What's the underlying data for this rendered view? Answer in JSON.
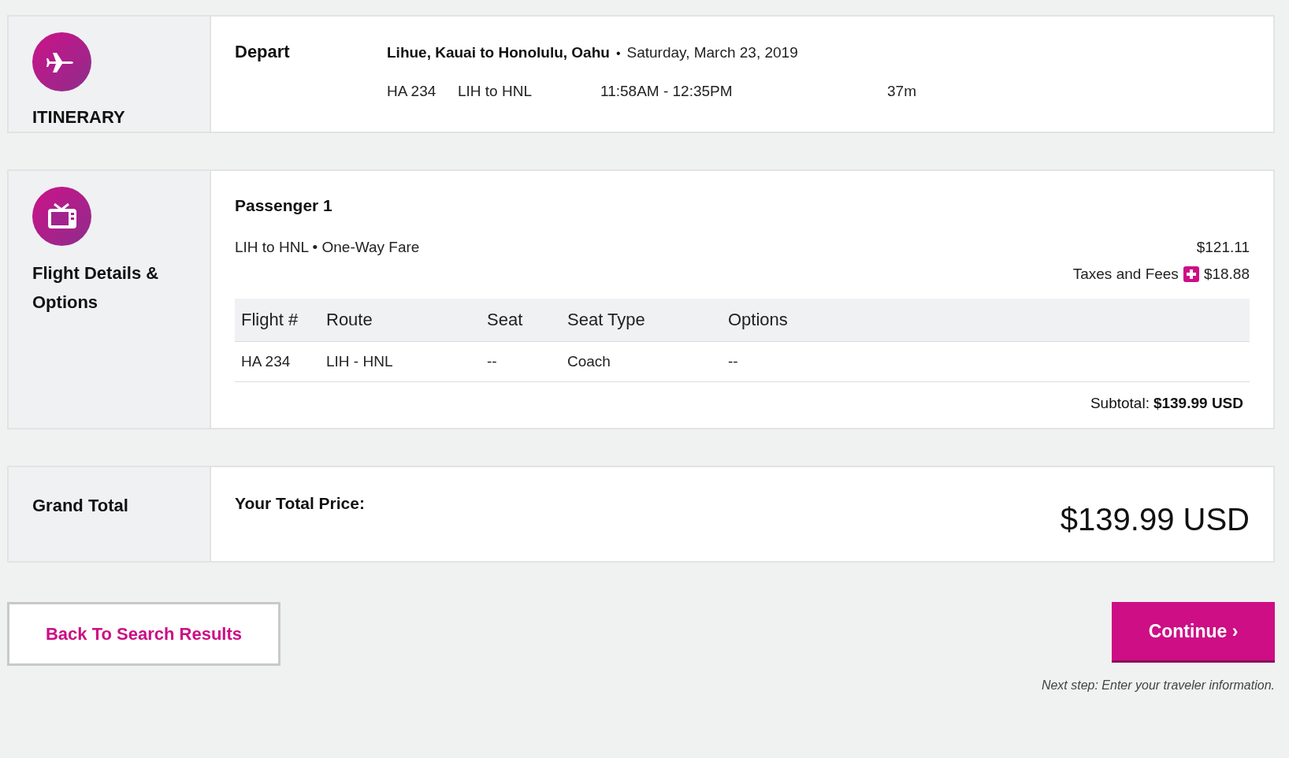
{
  "itinerary": {
    "heading": "ITINERARY",
    "label": "Depart",
    "route": "Lihue, Kauai to Honolulu, Oahu",
    "separator": "•",
    "date": "Saturday, March 23, 2019",
    "flight": {
      "number": "HA 234",
      "segment": "LIH to HNL",
      "time": "11:58AM - 12:35PM",
      "duration": "37m"
    }
  },
  "details": {
    "heading": "Flight Details & Options",
    "passenger": "Passenger 1",
    "fare_route": "LIH to HNL",
    "fare_separator": "•",
    "fare_type": "One-Way Fare",
    "fare_price": "$121.11",
    "taxes_label": "Taxes and Fees",
    "taxes_price": "$18.88",
    "table": {
      "columns": [
        "Flight #",
        "Route",
        "Seat",
        "Seat Type",
        "Options"
      ],
      "rows": [
        [
          "HA 234",
          "LIH - HNL",
          "--",
          "Coach",
          "--"
        ]
      ]
    },
    "subtotal_label": "Subtotal:",
    "subtotal_value": "$139.99 USD"
  },
  "grand_total": {
    "heading": "Grand Total",
    "label": "Your Total Price:",
    "value": "$139.99 USD"
  },
  "back_button": "Back To Search Results",
  "continue_button": "Continue ›",
  "next_step": "Next step: Enter your traveler information."
}
